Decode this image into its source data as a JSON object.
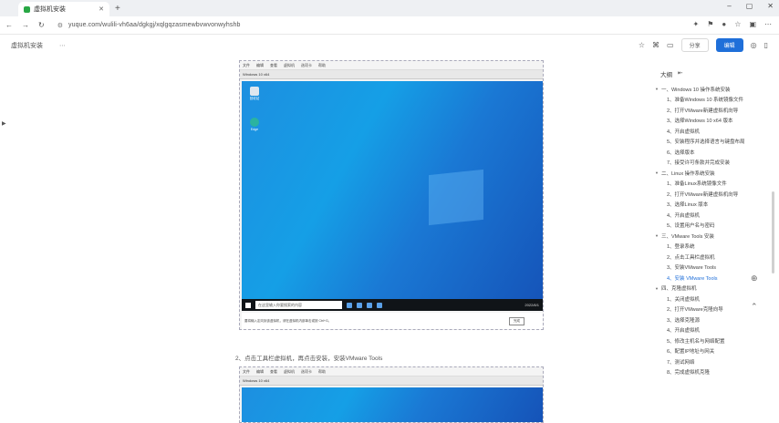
{
  "browser": {
    "tab_title": "虚拟机安装",
    "new_tab": "+",
    "url": "yuque.com/wulili-vh6aa/dgkgj/xqlgqzasmewbvwvonwyhshb",
    "window_controls": [
      "–",
      "▢",
      "✕"
    ]
  },
  "doc": {
    "breadcrumb": "虚拟机安装",
    "share_label": "分享",
    "edit_label": "编辑"
  },
  "vm1": {
    "menu": [
      "文件",
      "编辑",
      "查看",
      "虚拟机",
      "选项卡",
      "帮助"
    ],
    "title": "Windows 10 x64",
    "icons": [
      "回收站",
      "Edge"
    ],
    "search_placeholder": "在这里输入你要搜索的内容",
    "clock": "2022/8/1",
    "status_left": "要将输入定向到该虚拟机，请在虚拟机内部单击或按 Ctrl+G。",
    "status_ok": "完成"
  },
  "step_text": "2、点击工具栏虚拟机，再点击安装，安装VMware Tools",
  "vm2": {
    "menu": [
      "文件",
      "编辑",
      "查看",
      "虚拟机",
      "选项卡",
      "帮助"
    ],
    "title": "Windows 10 x64"
  },
  "outline": {
    "title": "大纲",
    "items": [
      {
        "level": 1,
        "text": "一、Windows 10 操作系统安装"
      },
      {
        "level": 2,
        "text": "1、准备Windows 10 系统镜像文件"
      },
      {
        "level": 2,
        "text": "2、打开VMware新建虚拟机向导"
      },
      {
        "level": 2,
        "text": "3、选择Windows 10 x64 版本"
      },
      {
        "level": 2,
        "text": "4、开启虚拟机"
      },
      {
        "level": 2,
        "text": "5、安装程序并选择语言与键盘布局"
      },
      {
        "level": 2,
        "text": "6、选择版本"
      },
      {
        "level": 2,
        "text": "7、接受许可条款并完成安装"
      },
      {
        "level": 1,
        "text": "二、Linux 操作系统安装"
      },
      {
        "level": 2,
        "text": "1、准备Linux系统镜像文件"
      },
      {
        "level": 2,
        "text": "2、打开VMware新建虚拟机向导"
      },
      {
        "level": 2,
        "text": "3、选择Linux 版本"
      },
      {
        "level": 2,
        "text": "4、开启虚拟机"
      },
      {
        "level": 2,
        "text": "5、设置用户名与密码"
      },
      {
        "level": 1,
        "text": "三、VMware Tools 安装"
      },
      {
        "level": 2,
        "text": "1、登录系统"
      },
      {
        "level": 2,
        "text": "2、点击工具栏虚拟机"
      },
      {
        "level": 2,
        "text": "3、安装VMware Tools"
      },
      {
        "level": 2,
        "text": "4、安装 VMware Tools",
        "active": true
      },
      {
        "level": 1,
        "text": "四、克隆虚拟机"
      },
      {
        "level": 2,
        "text": "1、关闭虚拟机"
      },
      {
        "level": 2,
        "text": "2、打开VMware克隆向导"
      },
      {
        "level": 2,
        "text": "3、选择克隆源"
      },
      {
        "level": 2,
        "text": "4、开启虚拟机"
      },
      {
        "level": 2,
        "text": "5、修改主机名与网络配置"
      },
      {
        "level": 2,
        "text": "6、配置IP地址与网关"
      },
      {
        "level": 2,
        "text": "7、测试网络"
      },
      {
        "level": 2,
        "text": "8、完成虚拟机克隆"
      }
    ]
  }
}
